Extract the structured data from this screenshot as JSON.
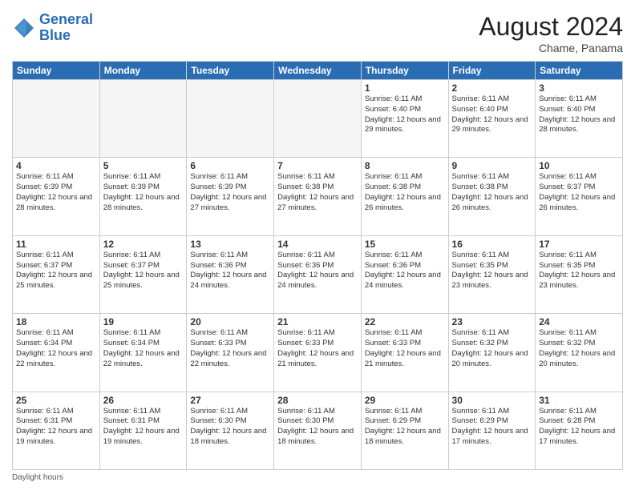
{
  "header": {
    "logo_line1": "General",
    "logo_line2": "Blue",
    "month_title": "August 2024",
    "location": "Chame, Panama"
  },
  "footer": {
    "note": "Daylight hours"
  },
  "weekdays": [
    "Sunday",
    "Monday",
    "Tuesday",
    "Wednesday",
    "Thursday",
    "Friday",
    "Saturday"
  ],
  "weeks": [
    [
      {
        "day": "",
        "empty": true
      },
      {
        "day": "",
        "empty": true
      },
      {
        "day": "",
        "empty": true
      },
      {
        "day": "",
        "empty": true
      },
      {
        "day": "1",
        "sunrise": "6:11 AM",
        "sunset": "6:40 PM",
        "daylight": "12 hours and 29 minutes."
      },
      {
        "day": "2",
        "sunrise": "6:11 AM",
        "sunset": "6:40 PM",
        "daylight": "12 hours and 29 minutes."
      },
      {
        "day": "3",
        "sunrise": "6:11 AM",
        "sunset": "6:40 PM",
        "daylight": "12 hours and 28 minutes."
      }
    ],
    [
      {
        "day": "4",
        "sunrise": "6:11 AM",
        "sunset": "6:39 PM",
        "daylight": "12 hours and 28 minutes."
      },
      {
        "day": "5",
        "sunrise": "6:11 AM",
        "sunset": "6:39 PM",
        "daylight": "12 hours and 28 minutes."
      },
      {
        "day": "6",
        "sunrise": "6:11 AM",
        "sunset": "6:39 PM",
        "daylight": "12 hours and 27 minutes."
      },
      {
        "day": "7",
        "sunrise": "6:11 AM",
        "sunset": "6:38 PM",
        "daylight": "12 hours and 27 minutes."
      },
      {
        "day": "8",
        "sunrise": "6:11 AM",
        "sunset": "6:38 PM",
        "daylight": "12 hours and 26 minutes."
      },
      {
        "day": "9",
        "sunrise": "6:11 AM",
        "sunset": "6:38 PM",
        "daylight": "12 hours and 26 minutes."
      },
      {
        "day": "10",
        "sunrise": "6:11 AM",
        "sunset": "6:37 PM",
        "daylight": "12 hours and 26 minutes."
      }
    ],
    [
      {
        "day": "11",
        "sunrise": "6:11 AM",
        "sunset": "6:37 PM",
        "daylight": "12 hours and 25 minutes."
      },
      {
        "day": "12",
        "sunrise": "6:11 AM",
        "sunset": "6:37 PM",
        "daylight": "12 hours and 25 minutes."
      },
      {
        "day": "13",
        "sunrise": "6:11 AM",
        "sunset": "6:36 PM",
        "daylight": "12 hours and 24 minutes."
      },
      {
        "day": "14",
        "sunrise": "6:11 AM",
        "sunset": "6:36 PM",
        "daylight": "12 hours and 24 minutes."
      },
      {
        "day": "15",
        "sunrise": "6:11 AM",
        "sunset": "6:36 PM",
        "daylight": "12 hours and 24 minutes."
      },
      {
        "day": "16",
        "sunrise": "6:11 AM",
        "sunset": "6:35 PM",
        "daylight": "12 hours and 23 minutes."
      },
      {
        "day": "17",
        "sunrise": "6:11 AM",
        "sunset": "6:35 PM",
        "daylight": "12 hours and 23 minutes."
      }
    ],
    [
      {
        "day": "18",
        "sunrise": "6:11 AM",
        "sunset": "6:34 PM",
        "daylight": "12 hours and 22 minutes."
      },
      {
        "day": "19",
        "sunrise": "6:11 AM",
        "sunset": "6:34 PM",
        "daylight": "12 hours and 22 minutes."
      },
      {
        "day": "20",
        "sunrise": "6:11 AM",
        "sunset": "6:33 PM",
        "daylight": "12 hours and 22 minutes."
      },
      {
        "day": "21",
        "sunrise": "6:11 AM",
        "sunset": "6:33 PM",
        "daylight": "12 hours and 21 minutes."
      },
      {
        "day": "22",
        "sunrise": "6:11 AM",
        "sunset": "6:33 PM",
        "daylight": "12 hours and 21 minutes."
      },
      {
        "day": "23",
        "sunrise": "6:11 AM",
        "sunset": "6:32 PM",
        "daylight": "12 hours and 20 minutes."
      },
      {
        "day": "24",
        "sunrise": "6:11 AM",
        "sunset": "6:32 PM",
        "daylight": "12 hours and 20 minutes."
      }
    ],
    [
      {
        "day": "25",
        "sunrise": "6:11 AM",
        "sunset": "6:31 PM",
        "daylight": "12 hours and 19 minutes."
      },
      {
        "day": "26",
        "sunrise": "6:11 AM",
        "sunset": "6:31 PM",
        "daylight": "12 hours and 19 minutes."
      },
      {
        "day": "27",
        "sunrise": "6:11 AM",
        "sunset": "6:30 PM",
        "daylight": "12 hours and 18 minutes."
      },
      {
        "day": "28",
        "sunrise": "6:11 AM",
        "sunset": "6:30 PM",
        "daylight": "12 hours and 18 minutes."
      },
      {
        "day": "29",
        "sunrise": "6:11 AM",
        "sunset": "6:29 PM",
        "daylight": "12 hours and 18 minutes."
      },
      {
        "day": "30",
        "sunrise": "6:11 AM",
        "sunset": "6:29 PM",
        "daylight": "12 hours and 17 minutes."
      },
      {
        "day": "31",
        "sunrise": "6:11 AM",
        "sunset": "6:28 PM",
        "daylight": "12 hours and 17 minutes."
      }
    ]
  ]
}
